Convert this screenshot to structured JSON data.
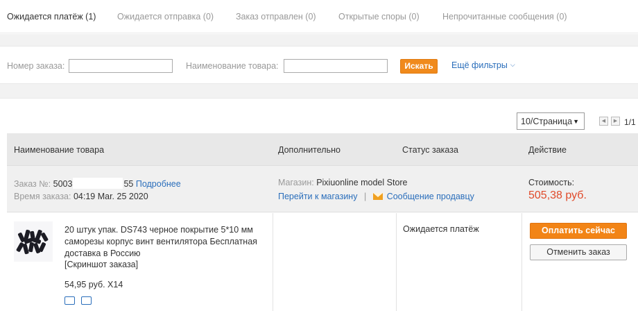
{
  "tabs": [
    {
      "label": "Ожидается платёж (1)",
      "active": true
    },
    {
      "label": "Ожидается отправка (0)",
      "active": false
    },
    {
      "label": "Заказ отправлен (0)",
      "active": false
    },
    {
      "label": "Открытые споры (0)",
      "active": false
    },
    {
      "label": "Непрочитанные сообщения (0)",
      "active": false
    }
  ],
  "filters": {
    "order_number_label": "Номер заказа:",
    "order_number_value": "",
    "product_name_label": "Наименование товара:",
    "product_name_value": "",
    "search_button": "Искать",
    "more_filters": "Ещё фильтры"
  },
  "pager": {
    "per_page": "10/Страница",
    "page_count": "1/1"
  },
  "table": {
    "headers": [
      "Наименование товара",
      "Дополнительно",
      "Статус заказа",
      "Действие"
    ]
  },
  "order": {
    "number_label": "Заказ №:",
    "number_start": "5003",
    "number_end": "55",
    "details_link": "Подробнее",
    "time_label": "Время заказа:",
    "time_value": "04:19 Mar. 25 2020",
    "store_label": "Магазин:",
    "store_name": "Pixiuonline model Store",
    "go_to_store": "Перейти к магазину",
    "separator": "|",
    "message_seller": "Сообщение продавцу",
    "cost_label": "Стоимость:",
    "cost_value": "505,38 руб."
  },
  "item": {
    "title": "20 штук упак. DS743 черное покрытие 5*10 мм саморезы корпус винт вентилятора Бесплатная доставка в Россию",
    "snapshot": "[Скриншот заказа]",
    "price": "54,95 руб. X14",
    "status": "Ожидается платёж",
    "pay_button": "Оплатить сейчас",
    "cancel_button": "Отменить заказ"
  },
  "colors": {
    "accent_orange": "#f28416",
    "link_blue": "#2a6ebb",
    "price_red": "#e04a2a"
  },
  "icons": [
    "chevron-down-icon",
    "envelope-icon",
    "truck-icon",
    "receipt-icon",
    "prev-page-icon",
    "next-page-icon"
  ]
}
